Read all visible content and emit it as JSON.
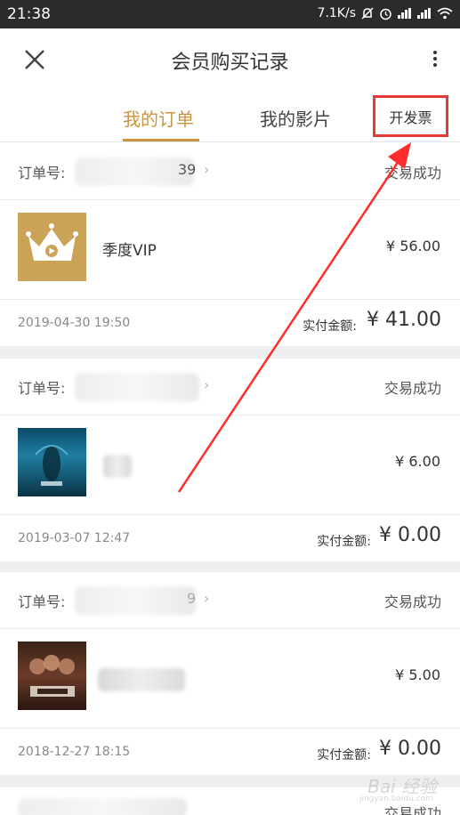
{
  "status_bar": {
    "time": "21:38",
    "network_speed": "7.1K/s",
    "icons": [
      "mute-bell-icon",
      "alarm-icon",
      "signal-icon",
      "signal-icon",
      "wifi-icon"
    ]
  },
  "header": {
    "title": "会员购买记录",
    "close_icon": "close-icon",
    "more_icon": "more-vertical-icon"
  },
  "tabs": {
    "orders": "我的订单",
    "films": "我的影片",
    "invoice": "开发票",
    "active": "orders",
    "accent_color": "#c9953f",
    "highlight_color": "#e53935"
  },
  "orders": [
    {
      "order_no_label": "订单号:",
      "order_no_visible_tail": "39",
      "status": "交易成功",
      "thumbnail": "vip-crown-thumbnail",
      "product_name": "季度VIP",
      "unit_price": "¥ 56.00",
      "date": "2019-04-30 19:50",
      "paid_label": "实付金额:",
      "paid_amount": "¥ 41.00"
    },
    {
      "order_no_label": "订单号:",
      "order_no_visible_tail": "",
      "status": "交易成功",
      "thumbnail": "movie-poster-thumbnail",
      "product_name": "",
      "unit_price": "¥ 6.00",
      "date": "2019-03-07 12:47",
      "paid_label": "实付金额:",
      "paid_amount": "¥ 0.00"
    },
    {
      "order_no_label": "订单号:",
      "order_no_visible_tail": "9",
      "status": "交易成功",
      "thumbnail": "movie-poster-thumbnail",
      "product_name": "",
      "unit_price": "¥ 5.00",
      "date": "2018-12-27 18:15",
      "paid_label": "实付金额:",
      "paid_amount": "¥ 0.00"
    },
    {
      "order_no_label": "",
      "order_no_visible_tail": "",
      "status": "交易成功"
    }
  ],
  "watermark": {
    "text": "Bai 经验",
    "sub": "jingyan.baidu.com"
  }
}
